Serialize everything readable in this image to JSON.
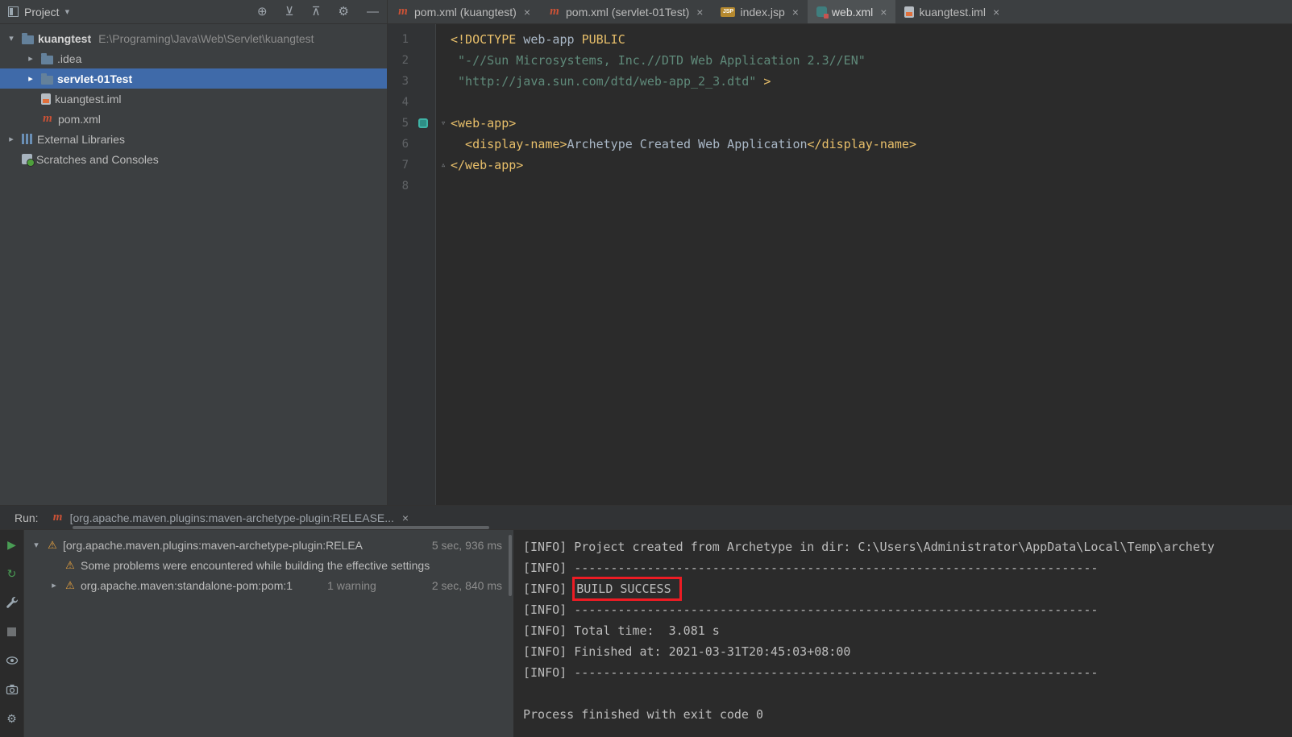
{
  "colors": {
    "panel_bg": "#3c3f41",
    "editor_bg": "#2b2b2b",
    "selection_blue": "#3f6aa9",
    "tag_yellow": "#e8bf6a",
    "string_teal": "#5f8a7a",
    "warning_yellow": "#e9a33f",
    "maven_orange": "#cc5236",
    "run_green": "#499c54",
    "highlight_red": "#ed1c24"
  },
  "icons": {
    "maven": "m",
    "jsp": "JSP",
    "close": "×",
    "chevron_down": "▾",
    "chevron_right": "▸",
    "warning": "⚠",
    "gear": "⚙",
    "locate": "⊕",
    "expand_all": "⊻",
    "collapse_all": "⊼",
    "hide": "―",
    "play": "▶",
    "restart": "↻",
    "fold_open": "▿",
    "fold_close": "▵"
  },
  "top_bar": {
    "project_selector_label": "Project"
  },
  "editor_tabs": [
    {
      "label": "pom.xml (kuangtest)",
      "icon": "maven",
      "active": false
    },
    {
      "label": "pom.xml (servlet-01Test)",
      "icon": "maven",
      "active": false
    },
    {
      "label": "index.jsp",
      "icon": "jsp",
      "active": false
    },
    {
      "label": "web.xml",
      "icon": "webxml",
      "active": true
    },
    {
      "label": "kuangtest.iml",
      "icon": "iml",
      "active": false
    }
  ],
  "project_tree": [
    {
      "chevron": "down",
      "icon": "folder",
      "label": "kuangtest",
      "path": "E:\\Programing\\Java\\Web\\Servlet\\kuangtest",
      "bold": true,
      "indent": 0
    },
    {
      "chevron": "right",
      "icon": "folder",
      "label": ".idea",
      "indent": 1
    },
    {
      "chevron": "right",
      "icon": "folder",
      "label": "servlet-01Test",
      "bold": true,
      "selected": true,
      "indent": 1
    },
    {
      "icon": "iml",
      "label": "kuangtest.iml",
      "indent": 1
    },
    {
      "icon": "maven",
      "label": "pom.xml",
      "indent": 1
    },
    {
      "chevron": "right",
      "icon": "library",
      "label": "External Libraries",
      "indent": 0
    },
    {
      "icon": "scratches",
      "label": "Scratches and Consoles",
      "indent": 0
    }
  ],
  "editor": {
    "lines": [
      {
        "num": "1",
        "segments": [
          {
            "c": "kw",
            "s": "<!DOCTYPE"
          },
          {
            "c": "plain",
            "s": " web-app "
          },
          {
            "c": "kw",
            "s": "PUBLIC"
          }
        ]
      },
      {
        "num": "2",
        "segments": [
          {
            "c": "str",
            "s": " \"-//Sun Microsystems, Inc.//DTD Web Application 2.3//EN\""
          }
        ]
      },
      {
        "num": "3",
        "segments": [
          {
            "c": "str",
            "s": " \"http://java.sun.com/dtd/web-app_2_3.dtd\""
          },
          {
            "c": "kw",
            "s": " >"
          }
        ]
      },
      {
        "num": "4",
        "segments": []
      },
      {
        "num": "5",
        "gutter": "webapp",
        "fold": "open",
        "segments": [
          {
            "c": "tag",
            "s": "<web-app>"
          }
        ]
      },
      {
        "num": "6",
        "segments": [
          {
            "c": "tag",
            "s": "  <display-name>"
          },
          {
            "c": "plain",
            "s": "Archetype Created Web Application"
          },
          {
            "c": "tag",
            "s": "</display-name>"
          }
        ]
      },
      {
        "num": "7",
        "fold": "close",
        "segments": [
          {
            "c": "tag",
            "s": "</web-app>"
          }
        ]
      },
      {
        "num": "8",
        "segments": []
      }
    ]
  },
  "run_panel": {
    "title": "Run:",
    "tab_label": "[org.apache.maven.plugins:maven-archetype-plugin:RELEASE...",
    "tree": [
      {
        "chevron": "down",
        "warn": true,
        "text": "[org.apache.maven.plugins:maven-archetype-plugin:RELEA",
        "time": "5 sec, 936 ms",
        "indent": 0
      },
      {
        "warn": true,
        "text": "Some problems were encountered while building the effective settings",
        "indent": 1
      },
      {
        "chevron": "right",
        "warn": true,
        "text": "org.apache.maven:standalone-pom:pom:1",
        "badge": "1 warning",
        "time": "2 sec, 840 ms",
        "indent": 1
      }
    ],
    "console": [
      {
        "text": "[INFO] Project created from Archetype in dir: C:\\Users\\Administrator\\AppData\\Local\\Temp\\archety"
      },
      {
        "text": "[INFO] ------------------------------------------------------------------------"
      },
      {
        "text": "[INFO] ",
        "boxed": "BUILD SUCCESS"
      },
      {
        "text": "[INFO] ------------------------------------------------------------------------"
      },
      {
        "text": "[INFO] Total time:  3.081 s"
      },
      {
        "text": "[INFO] Finished at: 2021-03-31T20:45:03+08:00"
      },
      {
        "text": "[INFO] ------------------------------------------------------------------------"
      },
      {
        "text": ""
      },
      {
        "text": "Process finished with exit code 0"
      }
    ]
  }
}
